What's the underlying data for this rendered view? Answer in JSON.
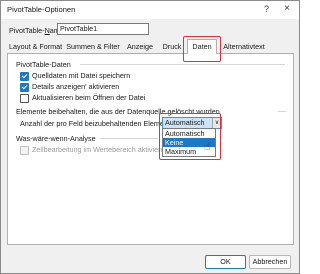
{
  "window": {
    "title": "PivotTable-Optionen",
    "help_icon": "?",
    "close_icon": "×"
  },
  "name_field": {
    "label": "PivotTable-Name:",
    "value": "PivotTable1"
  },
  "tabs": [
    {
      "label": "Layout & Format",
      "active": false
    },
    {
      "label": "Summen & Filter",
      "active": false
    },
    {
      "label": "Anzeige",
      "active": false
    },
    {
      "label": "Druck",
      "active": false
    },
    {
      "label": "Daten",
      "active": true
    },
    {
      "label": "Alternativtext",
      "active": false
    }
  ],
  "sections": {
    "pivot_data": {
      "heading": "PivotTable-Daten",
      "items": [
        {
          "label": "Quelldaten mit Datei speichern",
          "checked": true
        },
        {
          "label": "Details anzeigen' aktivieren",
          "checked": true
        },
        {
          "label": "Aktualisieren beim Öffnen der Datei",
          "checked": false
        }
      ]
    },
    "retain_items": {
      "heading": "Elemente beibehalten, die aus der Datenquelle gelöscht wurden",
      "dropdown_label": "Anzahl der pro Feld beizubehaltenden Elemente:",
      "selected": "Automatisch",
      "options": [
        "Automatisch",
        "Keine",
        "Maximum"
      ],
      "highlighted_option": "Keine"
    },
    "what_if": {
      "heading": "Was-wäre-wenn-Analyse",
      "item": {
        "label": "Zellbearbeitung im Wertebereich aktivieren",
        "checked": false,
        "disabled": true
      }
    }
  },
  "buttons": {
    "ok": "OK",
    "cancel": "Abbrechen"
  },
  "colors": {
    "accent": "#1e78c8",
    "highlight_box": "#e0313e"
  }
}
